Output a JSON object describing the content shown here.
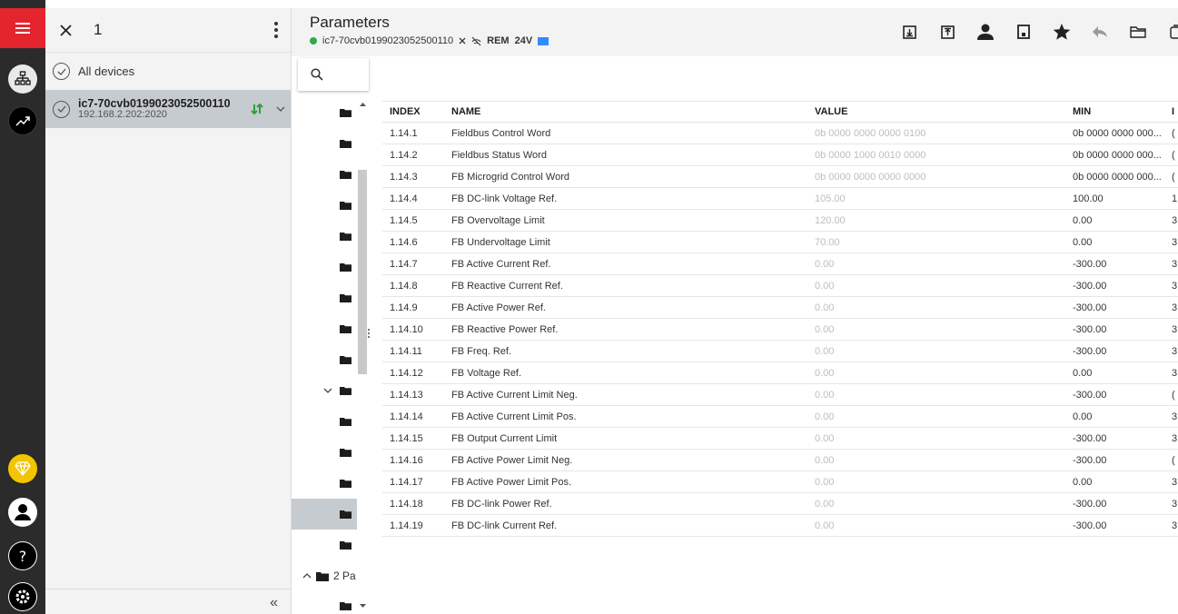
{
  "devices": {
    "selected_count": "1",
    "all_devices_label": "All devices",
    "items": [
      {
        "name": "ic7-70cvb0199023052500110",
        "address": "192.168.2.202:2020"
      }
    ],
    "collapse_label": "«"
  },
  "header": {
    "title": "Parameters",
    "device_id": "ic7-70cvb0199023052500110",
    "mode": "REM",
    "voltage": "24V"
  },
  "tree": {
    "expanded_group_label": "2 Pa"
  },
  "table": {
    "columns": {
      "index": "INDEX",
      "name": "NAME",
      "value": "VALUE",
      "min": "MIN",
      "max": "I"
    },
    "rows": [
      {
        "index": "1.14.1",
        "name": "Fieldbus Control Word",
        "value": "0b 0000 0000 0000 0100",
        "min": "0b 0000 0000 000...",
        "max": "("
      },
      {
        "index": "1.14.2",
        "name": "Fieldbus Status Word",
        "value": "0b 0000 1000 0010 0000",
        "min": "0b 0000 0000 000...",
        "max": "("
      },
      {
        "index": "1.14.3",
        "name": "FB Microgrid Control Word",
        "value": "0b 0000 0000 0000 0000",
        "min": "0b 0000 0000 000...",
        "max": "("
      },
      {
        "index": "1.14.4",
        "name": "FB DC-link Voltage Ref.",
        "value": "105.00",
        "min": "100.00",
        "max": "1"
      },
      {
        "index": "1.14.5",
        "name": "FB Overvoltage Limit",
        "value": "120.00",
        "min": "0.00",
        "max": "3"
      },
      {
        "index": "1.14.6",
        "name": "FB Undervoltage Limit",
        "value": "70.00",
        "min": "0.00",
        "max": "3"
      },
      {
        "index": "1.14.7",
        "name": "FB Active Current Ref.",
        "value": "0.00",
        "min": "-300.00",
        "max": "3"
      },
      {
        "index": "1.14.8",
        "name": "FB Reactive Current Ref.",
        "value": "0.00",
        "min": "-300.00",
        "max": "3"
      },
      {
        "index": "1.14.9",
        "name": "FB Active Power Ref.",
        "value": "0.00",
        "min": "-300.00",
        "max": "3"
      },
      {
        "index": "1.14.10",
        "name": "FB Reactive Power Ref.",
        "value": "0.00",
        "min": "-300.00",
        "max": "3"
      },
      {
        "index": "1.14.11",
        "name": "FB Freq. Ref.",
        "value": "0.00",
        "min": "-300.00",
        "max": "3"
      },
      {
        "index": "1.14.12",
        "name": "FB Voltage Ref.",
        "value": "0.00",
        "min": "0.00",
        "max": "3"
      },
      {
        "index": "1.14.13",
        "name": "FB Active Current Limit Neg.",
        "value": "0.00",
        "min": "-300.00",
        "max": "("
      },
      {
        "index": "1.14.14",
        "name": "FB Active Current Limit Pos.",
        "value": "0.00",
        "min": "0.00",
        "max": "3"
      },
      {
        "index": "1.14.15",
        "name": "FB Output Current Limit",
        "value": "0.00",
        "min": "-300.00",
        "max": "3"
      },
      {
        "index": "1.14.16",
        "name": "FB Active Power Limit Neg.",
        "value": "0.00",
        "min": "-300.00",
        "max": "("
      },
      {
        "index": "1.14.17",
        "name": "FB Active Power Limit Pos.",
        "value": "0.00",
        "min": "0.00",
        "max": "3"
      },
      {
        "index": "1.14.18",
        "name": "FB DC-link Power Ref.",
        "value": "0.00",
        "min": "-300.00",
        "max": "3"
      },
      {
        "index": "1.14.19",
        "name": "FB DC-link Current Ref.",
        "value": "0.00",
        "min": "-300.00",
        "max": "3"
      }
    ]
  },
  "icons": {
    "rail": [
      "menu-icon",
      "network-icon",
      "trend-icon",
      "diamond-icon",
      "user-icon",
      "help-icon",
      "settings-icon"
    ],
    "toolbar": [
      "download-icon",
      "upload-icon",
      "user-icon",
      "save-icon",
      "star-icon",
      "undo-icon",
      "folder-icon",
      "window-icon"
    ]
  },
  "colors": {
    "accent_red": "#e5252e",
    "status_green": "#2fa84f",
    "selection_gray": "#c6cbd0",
    "premium_yellow": "#f2c500",
    "flag_blue": "#2f8bff"
  }
}
